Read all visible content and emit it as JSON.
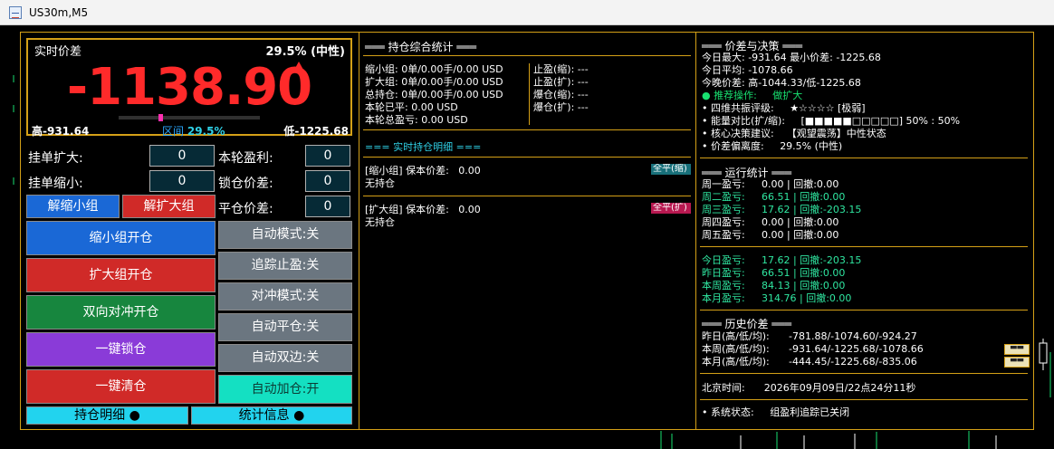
{
  "window": {
    "title": "US30m,M5",
    "subtitle": "▼"
  },
  "price": {
    "label": "实时价差",
    "pct": "29.5% (中性)",
    "value": "-1138.90",
    "high": "高-931.64",
    "low": "低-1225.68",
    "range_label": "区间",
    "range_pct": "29.5%",
    "marker_fraction": 0.295
  },
  "inputs": {
    "pending_expand": {
      "label": "挂单扩大:",
      "value": "0"
    },
    "pending_shrink": {
      "label": "挂单缩小:",
      "value": "0"
    },
    "round_profit": {
      "label": "本轮盈利:",
      "value": "0"
    },
    "lock_spread": {
      "label": "锁仓价差:",
      "value": "0"
    },
    "close_spread": {
      "label": "平仓价差:",
      "value": "0"
    }
  },
  "buttons": {
    "unlock_shrink": "解缩小组",
    "unlock_expand": "解扩大组",
    "open_shrink": "缩小组开仓",
    "open_expand": "扩大组开仓",
    "open_hedge": "双向对冲开仓",
    "lock_all": "一键锁仓",
    "close_all": "一键清仓",
    "auto_mode": "自动模式:关",
    "trail_stop": "追踪止盈:关",
    "hedge_mode": "对冲模式:关",
    "auto_close": "自动平仓:关",
    "auto_double": "自动双边:关",
    "auto_add": "自动加仓:开",
    "positions_detail": "持仓明细 ●",
    "stats_info": "统计信息 ●"
  },
  "summary": {
    "title": "═══ 持仓综合统计 ═══",
    "left_lines": [
      "缩小组: 0单/0.00手/0.00 USD",
      "扩大组: 0单/0.00手/0.00 USD",
      "总持仓: 0单/0.00手/0.00 USD",
      "本轮已平: 0.00 USD",
      "本轮总盈亏: 0.00 USD"
    ],
    "right_lines": [
      "止盈(缩): ---",
      "止盈(扩): ---",
      "爆仓(缩): ---",
      "爆仓(扩): ---"
    ]
  },
  "detail": {
    "title": "=== 实时持仓明细 ===",
    "shrink": {
      "header": "[缩小组] 保本价差:",
      "breakeven": "0.00",
      "status": "无持仓",
      "btn": "全平(缩)"
    },
    "expand": {
      "header": "[扩大组] 保本价差:",
      "breakeven": "0.00",
      "status": "无持仓",
      "btn": "全平(扩)"
    }
  },
  "decision": {
    "title": "═══ 价差与决策 ═══",
    "max_min": "今日最大: -931.64    最小价差: -1225.68",
    "avg": "今日平均: -1078.66",
    "tonight": "今晚价差:      高-1044.33/低-1225.68",
    "recommend_label": "● 推荐操作:",
    "recommend_value": "做扩大",
    "rating_label": "• 四维共振评级:",
    "rating_value": "★☆☆☆☆ [极弱]",
    "energy_label": "• 能量对比(扩/缩):",
    "energy_value": "[■■■■■□□□□□] 50% : 50%",
    "advice_label": "• 核心决策建议:",
    "advice_value": "【观望震荡】中性状态",
    "deviation_label": "• 价差偏离度:",
    "deviation_value": "29.5% (中性)"
  },
  "weekly": {
    "title": "═══ 运行统计 ═══",
    "rows": [
      {
        "label": "周一盈亏:",
        "value": "0.00 | 回撤:0.00",
        "color": "#ffffff"
      },
      {
        "label": "周二盈亏:",
        "value": "66.51 | 回撤:0.00",
        "color": "#2fe6a0"
      },
      {
        "label": "周三盈亏:",
        "value": "17.62 | 回撤:-203.15",
        "color": "#2fe6a0"
      },
      {
        "label": "周四盈亏:",
        "value": "0.00 | 回撤:0.00",
        "color": "#ffffff"
      },
      {
        "label": "周五盈亏:",
        "value": "0.00 | 回撤:0.00",
        "color": "#ffffff"
      }
    ]
  },
  "periods": {
    "rows": [
      {
        "label": "今日盈亏:",
        "value": "17.62 | 回撤:-203.15"
      },
      {
        "label": "昨日盈亏:",
        "value": "66.51 | 回撤:0.00"
      },
      {
        "label": "本周盈亏:",
        "value": "84.13 | 回撤:0.00"
      },
      {
        "label": "本月盈亏:",
        "value": "314.76 | 回撤:0.00"
      }
    ]
  },
  "history": {
    "title": "═══ 历史价差 ═══",
    "rows": [
      {
        "label": "昨日(高/低/均):",
        "value": "-781.88/-1074.60/-924.27"
      },
      {
        "label": "本周(高/低/均):",
        "value": "-931.64/-1225.68/-1078.66"
      },
      {
        "label": "本月(高/低/均):",
        "value": "-444.45/-1225.68/-835.06"
      }
    ]
  },
  "clock": {
    "label": "北京时间:",
    "value": "2026年09月09日/22点24分11秒"
  },
  "system": {
    "label": "• 系统状态:",
    "value": "组盈利追踪已关闭"
  },
  "colors": {
    "border": "#d4a017",
    "price_red": "#ff2a2a",
    "accent_cyan": "#2fd0e6",
    "profit_green": "#2fe6a0"
  }
}
